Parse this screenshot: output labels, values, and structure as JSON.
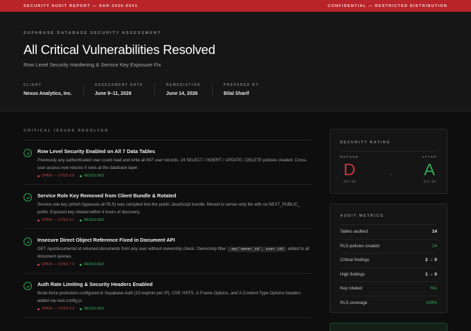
{
  "topbar": {
    "left": "SECURITY AUDIT REPORT — SAR-2026-0041",
    "right": "CONFIDENTIAL — RESTRICTED DISTRIBUTION"
  },
  "hero": {
    "eyebrow": "SUPABASE DATABASE SECURITY ASSESSMENT",
    "title": "All Critical Vulnerabilities Resolved",
    "subtitle": "Row Level Security Hardening & Service Key Exposure Fix",
    "meta": [
      {
        "key": "CLIENT",
        "value": "Nexus Analytics, Inc."
      },
      {
        "key": "ASSESSMENT DATE",
        "value": "June 9–11, 2026"
      },
      {
        "key": "REMEDIATION",
        "value": "June 14, 2026"
      },
      {
        "key": "PREPARED BY",
        "value": "Bilal Sharif"
      }
    ]
  },
  "issues": {
    "section_title": "CRITICAL ISSUES RESOLVED",
    "items": [
      {
        "title": "Row Level Security Enabled on All 7 Data Tables",
        "desc": "Previously any authenticated user could read and write all 847 user records. 24 SELECT / INSERT / UPDATE / DELETE policies created. Cross-user access now returns 0 rows at the database layer.",
        "open": "OPEN — CVSS 9.8",
        "resolved": "RESOLVED"
      },
      {
        "title": "Service Role Key Removed from Client Bundle & Rotated",
        "desc": "Service role key (which bypasses all RLS) was compiled into the public JavaScript bundle. Moved to server-only file with no NEXT_PUBLIC_ prefix. Exposed key rotated within 4 hours of discovery.",
        "open": "OPEN — CVSS 9.1",
        "resolved": "RESOLVED"
      },
      {
        "title": "Insecure Direct Object Reference Fixed in Document API",
        "desc_pre": "GET /api/documents/:id returned documents from any user without ownership check. Ownership filter ",
        "code": ".eq('owner_id', user.id)",
        "desc_post": " added to all document queries.",
        "open": "OPEN — CVSS 7.4",
        "resolved": "RESOLVED"
      },
      {
        "title": "Auth Rate Limiting & Security Headers Enabled",
        "desc": "Brute-force protection configured in Supabase Auth (10 req/min per IP). CSP, HSTS, X-Frame-Options, and X-Content-Type-Options headers added via next.config.js.",
        "open": "OPEN — CVSS 5.3",
        "resolved": "RESOLVED"
      }
    ]
  },
  "rating": {
    "title": "SECURITY RATING",
    "before_label": "BEFORE",
    "before_grade": "D",
    "before_score": "3.4 / 10",
    "arrow": "→",
    "after_label": "AFTER",
    "after_grade": "A",
    "after_score": "9.1 / 10",
    "before_color": "#c8333a",
    "after_color": "#2faa52"
  },
  "metrics": {
    "title": "AUDIT METRICS",
    "rows": [
      {
        "label": "Tables audited",
        "value": "14"
      },
      {
        "label": "RLS policies created",
        "value": "24"
      },
      {
        "label": "Critical findings",
        "value": "2 → 0"
      },
      {
        "label": "High findings",
        "value": "1 → 0"
      },
      {
        "label": "Key rotated",
        "value": "Yes"
      },
      {
        "label": "RLS coverage",
        "value": "100%"
      }
    ]
  }
}
